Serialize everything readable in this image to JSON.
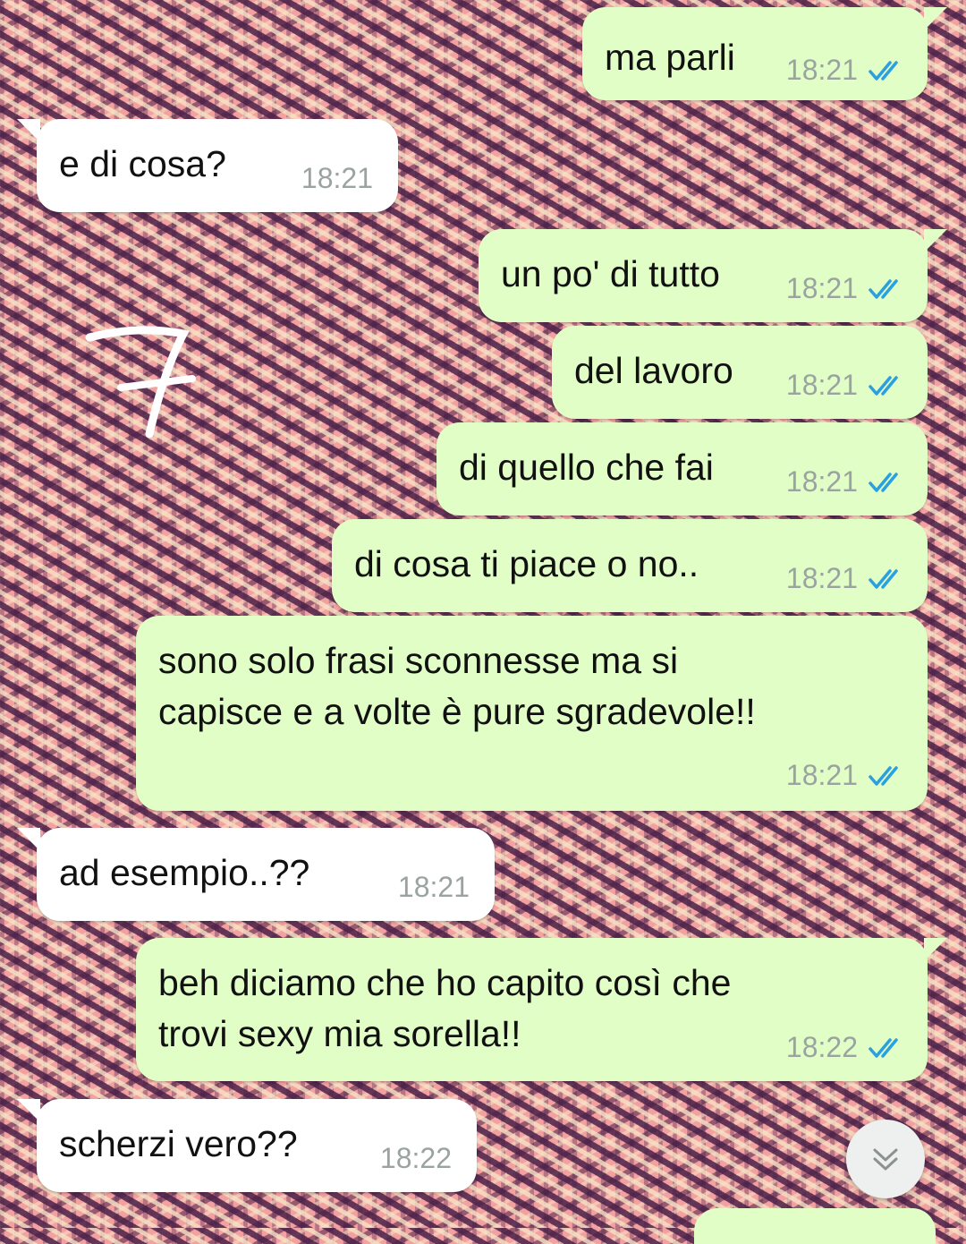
{
  "messages": [
    {
      "dir": "out",
      "text": "ma parli",
      "time": "18:21"
    },
    {
      "dir": "in",
      "text": "e di cosa?",
      "time": "18:21"
    },
    {
      "dir": "out",
      "text": "un po' di tutto",
      "time": "18:21"
    },
    {
      "dir": "out",
      "text": "del lavoro",
      "time": "18:21"
    },
    {
      "dir": "out",
      "text": "di quello che fai",
      "time": "18:21"
    },
    {
      "dir": "out",
      "text": "di cosa ti piace o no..",
      "time": "18:21"
    },
    {
      "dir": "out",
      "text_line1": "sono solo frasi sconnesse ma si",
      "text_line2": "capisce e a volte è pure sgradevole!!",
      "time": "18:21"
    },
    {
      "dir": "in",
      "text": "ad esempio..??",
      "time": "18:21"
    },
    {
      "dir": "out",
      "text_line1": "beh diciamo che ho capito così che",
      "text_line2": "trovi sexy mia sorella!!",
      "time": "18:22"
    },
    {
      "dir": "in",
      "text": "scherzi vero??",
      "time": "18:22"
    }
  ],
  "colors": {
    "outgoing": "#e1fec6",
    "incoming": "#ffffff",
    "read_ticks": "#2aa0e0",
    "time_text": "#9aa3a0"
  },
  "icons": {
    "read_receipt": "double-check-icon",
    "scroll": "chevron-double-down-icon"
  }
}
